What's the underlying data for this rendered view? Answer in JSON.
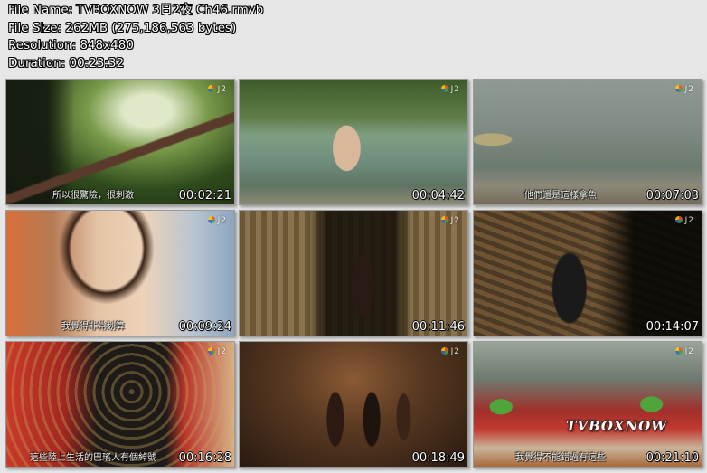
{
  "file_info": {
    "name": "File Name: TVBOXNOW 3日2夜 Ch46.rmvb",
    "size": "File Size: 262MB (275,186,563 bytes)",
    "resolution": "Resolution: 848x480",
    "duration": "Duration: 00:23:32"
  },
  "channel_logo": "J2",
  "watermark": "TVBOXNOW",
  "thumbnails": [
    {
      "timestamp": "00:02:21",
      "subtitle": "所以很驚險，很刺激"
    },
    {
      "timestamp": "00:04:42",
      "subtitle": ""
    },
    {
      "timestamp": "00:07:03",
      "subtitle": "他們還是這樣拿魚"
    },
    {
      "timestamp": "00:09:24",
      "subtitle": "我覺得非常划算"
    },
    {
      "timestamp": "00:11:46",
      "subtitle": ""
    },
    {
      "timestamp": "00:14:07",
      "subtitle": ""
    },
    {
      "timestamp": "00:16:28",
      "subtitle": "這些陸上生活的巴瑤人有個綽號"
    },
    {
      "timestamp": "00:18:49",
      "subtitle": ""
    },
    {
      "timestamp": "00:21:10",
      "subtitle": "我覺得不能錯過有這些"
    }
  ]
}
